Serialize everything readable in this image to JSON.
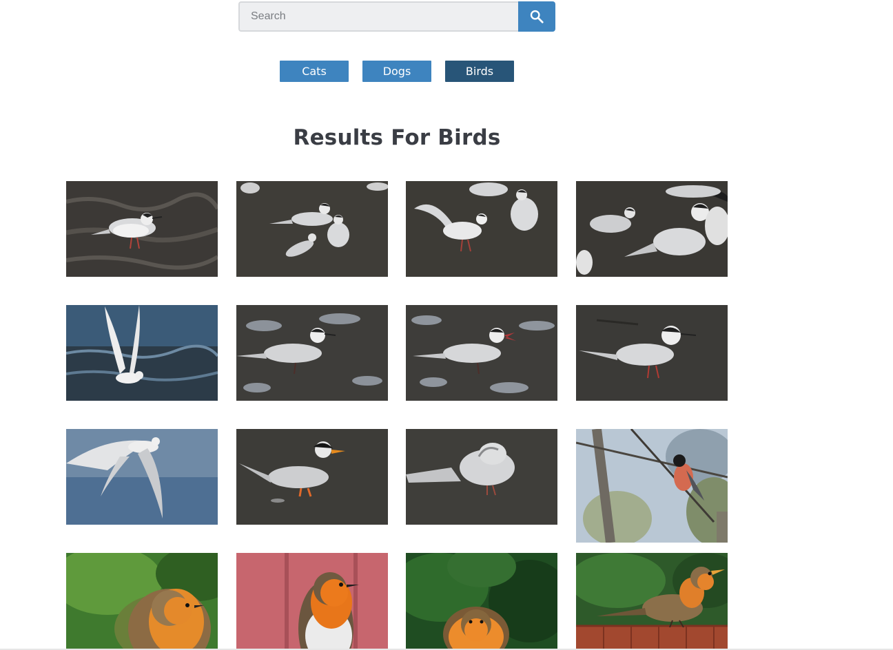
{
  "search": {
    "placeholder": "Search",
    "button_icon": "search-icon"
  },
  "categories": [
    {
      "label": "Cats",
      "active": false
    },
    {
      "label": "Dogs",
      "active": false
    },
    {
      "label": "Birds",
      "active": true
    }
  ],
  "heading": "Results For Birds",
  "colors": {
    "button": "#3e84bf",
    "button_active": "#285578",
    "heading": "#3a3d44"
  },
  "images": [
    {
      "subject": "tern standing on rippled sand"
    },
    {
      "subject": "three terns on wet mud"
    },
    {
      "subject": "tern spreading wings beside another tern"
    },
    {
      "subject": "group of terns on mud"
    },
    {
      "subject": "tern with wings raised over water"
    },
    {
      "subject": "tern walking on tidal flat"
    },
    {
      "subject": "tern calling on tidal flat"
    },
    {
      "subject": "tern resting on mudflat"
    },
    {
      "subject": "tern in flight"
    },
    {
      "subject": "black-capped tern with orange bill"
    },
    {
      "subject": "tern preening on mud"
    },
    {
      "subject": "bullfinch perched on branch"
    },
    {
      "subject": "robin in front of green foliage"
    },
    {
      "subject": "robin in front of pink wall"
    },
    {
      "subject": "robin in front of dark green bush"
    },
    {
      "subject": "robin perched on wooden fence"
    }
  ]
}
